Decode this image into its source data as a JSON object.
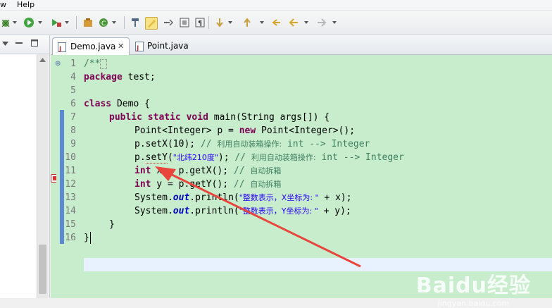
{
  "menubar": {
    "items": [
      "w",
      "Help"
    ]
  },
  "toolbar": {
    "icons": [
      "debug-icon",
      "run-icon",
      "coverage-icon",
      "new-java-package-icon",
      "new-class-icon",
      "open-type-icon",
      "toggle-mark-occurrences-icon",
      "show-whitespace-icon",
      "block-selection-icon",
      "next-annotation-icon",
      "previous-annotation-icon",
      "last-edit-location-icon",
      "back-icon",
      "forward-icon"
    ]
  },
  "editor": {
    "tabs": [
      {
        "label": "Demo.java",
        "active": true,
        "close": "✕"
      },
      {
        "label": "Point.java",
        "active": false
      }
    ],
    "line_numbers": [
      "1",
      "4",
      "5",
      "6",
      "7",
      "8",
      "9",
      "10",
      "11",
      "12",
      "13",
      "14",
      "15",
      "16"
    ],
    "lines": {
      "l1_fold": "⊕",
      "l1": "/**",
      "l4_kw": "package",
      "l4_rest": " test;",
      "l6_kw": "class",
      "l6_rest": " Demo {",
      "l7_kw1": "public",
      "l7_kw2": "static",
      "l7_kw3": "void",
      "l7_rest": " main(String args[]) {",
      "l8_a": "Point<Integer> p = ",
      "l8_kw": "new",
      "l8_b": " Point<Integer>();",
      "l9_a": "p.setX(10); ",
      "l9_cm1": "// ",
      "l9_cn": "利用自动装箱操作:",
      "l9_cm2": " int --> Integer",
      "l10_a": "p.",
      "l10_err": "setY",
      "l10_b": "(",
      "l10_st": "\"北纬210度\"",
      "l10_c": "); ",
      "l10_cm1": "// ",
      "l10_cn": "利用自动装箱操作:",
      "l10_cm2": " int --> Integer",
      "l11_kw": "int",
      "l11_a": " x = p.getX(); ",
      "l11_cm": "// ",
      "l11_cn": "自动拆箱",
      "l12_kw": "int",
      "l12_a": " y = p.getY(); ",
      "l12_cm": "// ",
      "l12_cn": "自动拆箱",
      "l13_a": "System.",
      "l13_fld": "out",
      "l13_b": ".println(",
      "l13_st": "\"整数表示，X坐标为: \"",
      "l13_c": " + x);",
      "l14_a": "System.",
      "l14_fld": "out",
      "l14_b": ".println(",
      "l14_st": "\"整数表示，Y坐标为: \"",
      "l14_c": " + y);",
      "l15": "}",
      "l16": "}"
    }
  },
  "watermark": {
    "main": "Baidu经验",
    "sub": "jingyan.baidu.com"
  },
  "colors": {
    "editor_bg": "#c7edcc",
    "keyword": "#7f0055",
    "comment": "#3f7f5f",
    "string": "#2a00ff",
    "arrow": "#e8453c"
  }
}
